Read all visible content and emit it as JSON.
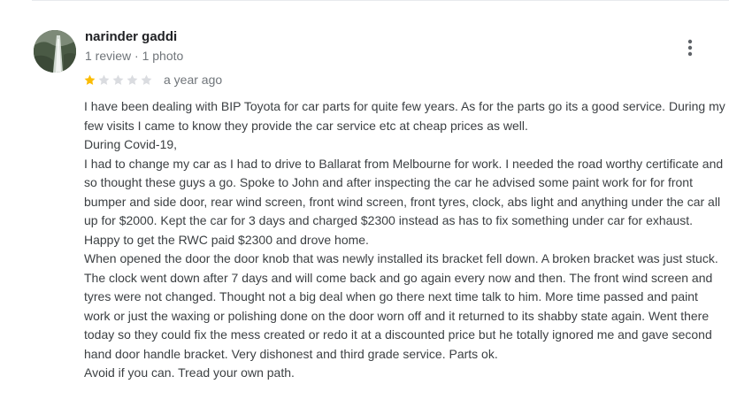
{
  "review": {
    "author_name": "narinder gaddi",
    "author_meta": "1 review · 1 photo",
    "rating": 1,
    "rating_max": 5,
    "date": "a year ago",
    "star_colors": {
      "filled": "#fbbc04",
      "empty": "#dadce0"
    },
    "more_icon": "more-vert-icon",
    "paragraphs": [
      "I have been dealing with BIP Toyota for car parts for quite few years. As for the parts go its a good service. During my few visits I came to know they provide the car service etc at cheap prices as well.",
      "During Covid-19,",
      "I had to change my car as I had to drive to Ballarat from Melbourne for work. I needed the road worthy certificate and so thought these guys a go. Spoke to John and after inspecting the car he advised some paint work for for front bumper and side door, rear wind screen, front wind screen, front tyres, clock, abs light and anything under the car all up for $2000. Kept the car for 3 days and charged $2300 instead as has to fix something under car for exhaust. Happy to get the RWC paid $2300 and drove home.",
      "When opened the door the door knob that was newly installed its bracket fell down. A broken bracket was just stuck. The clock went down after 7 days and will come back and go again every now and then. The front wind screen and tyres were not changed. Thought not a big deal when go there next time talk to him. More time passed and paint work or just the waxing or polishing done on the door worn off and it returned to its shabby state again. Went there today so they could fix the mess created or redo it at a discounted price but he totally ignored me and gave second hand door handle bracket. Very dishonest and third grade service. Parts ok.",
      "Avoid if you can. Tread your own path."
    ]
  }
}
